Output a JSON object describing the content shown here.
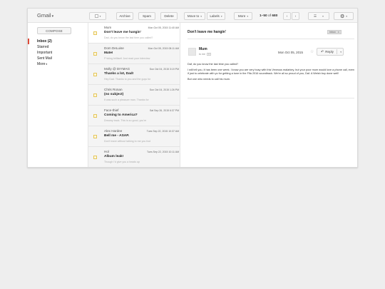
{
  "app": {
    "logo": "Gmail"
  },
  "toolbar": {
    "archive": "Archive",
    "spam": "Spam",
    "delete": "Delete",
    "move_to": "Move to",
    "labels": "Labels",
    "more": "More",
    "page_range": "1–50",
    "page_of": "of",
    "page_total": "680"
  },
  "sidebar": {
    "compose": "COMPOSE",
    "items": [
      {
        "label": "Inbox (2)",
        "active": true
      },
      {
        "label": "Starred"
      },
      {
        "label": "Important"
      },
      {
        "label": "Sent Mail"
      },
      {
        "label": "More"
      }
    ]
  },
  "messages": [
    {
      "from": "Mum",
      "date": "Mon Oct 05, 2015 11:40 AM",
      "subject": "Don't leave me hangin'",
      "snippet": "Dad, do you know the last time you called?",
      "selected": true
    },
    {
      "from": "Dom DeLuise",
      "date": "Mon Oct 05, 2015 08:11 AM",
      "subject": "Mate!",
      "snippet": "F*cking brilliant! Just read your interview"
    },
    {
      "from": "Molly @ DIYMAG",
      "date": "Sun Oct 04, 2015 3:19 PM",
      "subject": "Thanks a lot, Dad!",
      "snippet": "Hey Dad. Thanks to you and the guys for"
    },
    {
      "from": "Chris Ronan",
      "date": "Sun Oct 04, 2015 1:26 PM",
      "subject": "(no subject)",
      "snippet": "It was such a pleasure man. Thanks for"
    },
    {
      "from": "Face-thief",
      "date": "Sat Sep 26, 2015 6:37 PM",
      "subject": "Coming to America?",
      "snippet": "Dreamy track. This is so good, you're"
    },
    {
      "from": "Alex Hardee",
      "date": "Tues Sep 22, 2015 10:37 AM",
      "subject": "Bell me - ASAP.",
      "snippet": "Don't leave without talking to me you fool"
    },
    {
      "from": "Hol",
      "date": "Tues Sep 22, 2015 10:11 AM",
      "subject": "Album leak!",
      "snippet": "Though I'd give you a heads up"
    }
  ],
  "reader": {
    "subject": "Don't leave me hangin'",
    "tag": "Inbox",
    "tag_close": "x",
    "sender": "Mum",
    "to": "to me",
    "date": "Mon Oct 05, 2015",
    "star": "☆",
    "reply": "Reply",
    "reply_icon": "reply-arrow",
    "body": [
      "Daf, do you know the last time you called?",
      "I will tell you, it has been one week. I know you are very busy with this Vexeous malarkey, but your poor mum would love a phone call, even if just to celebrate with yo for getting a tune in the Fifa 2016 soundtrack. We're all so proud of you, Daf. A Welsh boy done well!",
      "But one who needs to call his mum."
    ]
  }
}
